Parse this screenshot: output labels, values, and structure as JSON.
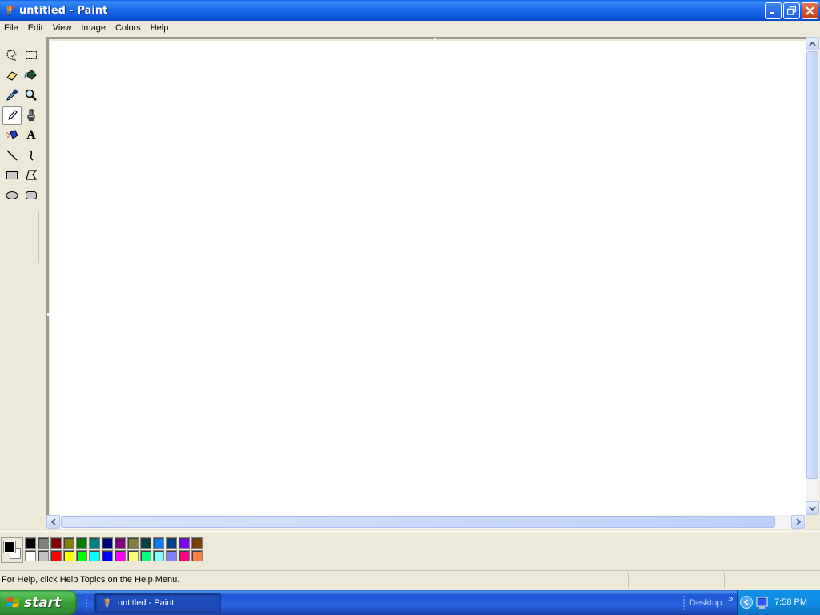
{
  "window": {
    "title": "untitled - Paint",
    "buttons": [
      "minimize",
      "restore",
      "close"
    ]
  },
  "menu": [
    "File",
    "Edit",
    "View",
    "Image",
    "Colors",
    "Help"
  ],
  "tools": [
    {
      "name": "free-form-select",
      "icon": "free-select-icon"
    },
    {
      "name": "select",
      "icon": "rect-select-icon"
    },
    {
      "name": "eraser",
      "icon": "eraser-icon"
    },
    {
      "name": "fill-with-color",
      "icon": "fill-bucket-icon"
    },
    {
      "name": "pick-color",
      "icon": "eyedropper-icon"
    },
    {
      "name": "magnifier",
      "icon": "magnifier-icon"
    },
    {
      "name": "pencil",
      "icon": "pencil-icon",
      "selected": true
    },
    {
      "name": "brush",
      "icon": "brush-icon"
    },
    {
      "name": "airbrush",
      "icon": "airbrush-icon"
    },
    {
      "name": "text",
      "icon": "text-icon",
      "glyph": "A"
    },
    {
      "name": "line",
      "icon": "line-icon"
    },
    {
      "name": "curve",
      "icon": "curve-icon"
    },
    {
      "name": "rectangle",
      "icon": "rectangle-icon"
    },
    {
      "name": "polygon",
      "icon": "polygon-icon"
    },
    {
      "name": "ellipse",
      "icon": "ellipse-icon"
    },
    {
      "name": "rounded-rectangle",
      "icon": "rounded-rect-icon"
    }
  ],
  "palette": {
    "foreground": "#000000",
    "background": "#ffffff",
    "row1": [
      "#000000",
      "#808080",
      "#800000",
      "#808000",
      "#008000",
      "#008080",
      "#000080",
      "#800080",
      "#808040",
      "#004040",
      "#0080ff",
      "#004080",
      "#8000ff",
      "#804000"
    ],
    "row2": [
      "#ffffff",
      "#c0c0c0",
      "#ff0000",
      "#ffff00",
      "#00ff00",
      "#00ffff",
      "#0000ff",
      "#ff00ff",
      "#ffff80",
      "#00ff80",
      "#80ffff",
      "#8080ff",
      "#ff0080",
      "#ff8040"
    ]
  },
  "status": {
    "help_text": "For Help, click Help Topics on the Help Menu."
  },
  "taskbar": {
    "start_label": "start",
    "task_label": "untitled - Paint",
    "desktop_label": "Desktop",
    "chevron": "»",
    "clock": "7:58 PM"
  }
}
